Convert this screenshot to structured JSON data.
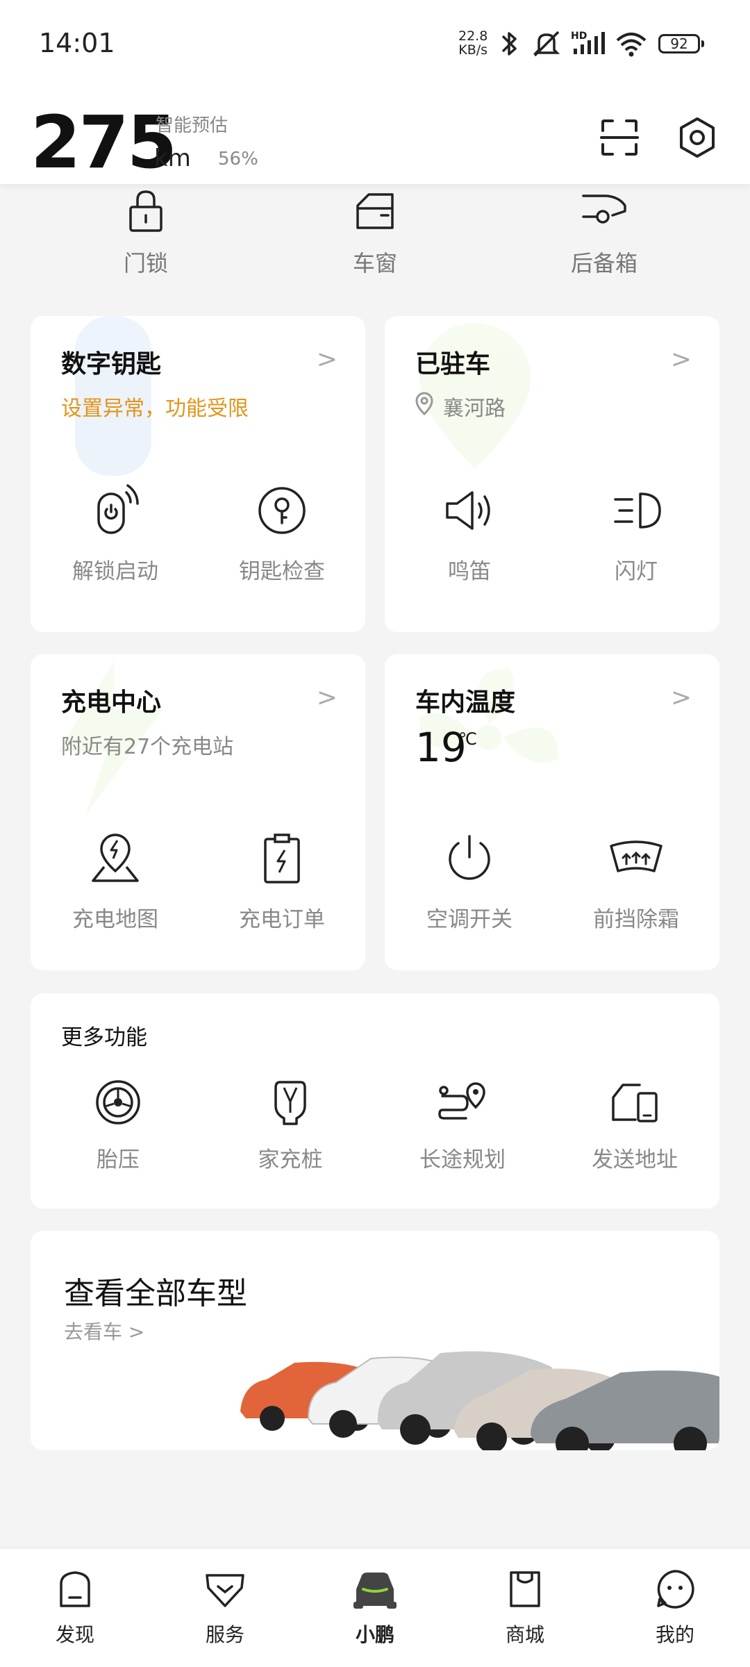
{
  "status_bar": {
    "time": "14:01",
    "net_speed_value": "22.8",
    "net_speed_unit": "KB/s",
    "network_label": "HD",
    "battery": "92",
    "icons": [
      "bluetooth-icon",
      "mute-icon",
      "signal-icon",
      "wifi-icon",
      "battery-icon"
    ]
  },
  "header": {
    "range_value": "275",
    "range_label": "智能预估",
    "range_unit": "km",
    "battery_percent": "56%",
    "icons": [
      "scan-icon",
      "settings-icon"
    ]
  },
  "quick_controls": [
    {
      "label": "门锁",
      "icon": "lock-icon"
    },
    {
      "label": "车窗",
      "icon": "window-icon"
    },
    {
      "label": "后备箱",
      "icon": "trunk-icon"
    }
  ],
  "cards": {
    "digital_key": {
      "title": "数字钥匙",
      "subtitle": "设置异常，功能受限",
      "subtitle_color": "#e0951a",
      "actions": [
        {
          "label": "解锁启动",
          "icon": "unlock-start-icon"
        },
        {
          "label": "钥匙检查",
          "icon": "key-check-icon"
        }
      ]
    },
    "parked": {
      "title": "已驻车",
      "location": "襄河路",
      "actions": [
        {
          "label": "鸣笛",
          "icon": "horn-icon"
        },
        {
          "label": "闪灯",
          "icon": "flash-light-icon"
        }
      ]
    },
    "charging": {
      "title": "充电中心",
      "subtitle": "附近有27个充电站",
      "actions": [
        {
          "label": "充电地图",
          "icon": "charge-map-icon"
        },
        {
          "label": "充电订单",
          "icon": "charge-order-icon"
        }
      ]
    },
    "temperature": {
      "title": "车内温度",
      "value": "19",
      "unit": "℃",
      "actions": [
        {
          "label": "空调开关",
          "icon": "power-icon"
        },
        {
          "label": "前挡除霜",
          "icon": "defrost-icon"
        }
      ]
    }
  },
  "more": {
    "title": "更多功能",
    "items": [
      {
        "label": "胎压",
        "icon": "tire-icon"
      },
      {
        "label": "家充桩",
        "icon": "home-charger-icon"
      },
      {
        "label": "长途规划",
        "icon": "route-icon"
      },
      {
        "label": "发送地址",
        "icon": "send-address-icon"
      }
    ]
  },
  "promo": {
    "title": "查看全部车型",
    "link": "去看车",
    "car_colors": [
      "#e2643a",
      "#f2f2f2",
      "#c9c9c9",
      "#d8cfc6",
      "#8e9398"
    ]
  },
  "bottom_nav": [
    {
      "label": "发现",
      "icon": "discover-icon",
      "active": false
    },
    {
      "label": "服务",
      "icon": "service-icon",
      "active": false
    },
    {
      "label": "小鹏",
      "icon": "car-icon",
      "active": true
    },
    {
      "label": "商城",
      "icon": "mall-icon",
      "active": false
    },
    {
      "label": "我的",
      "icon": "profile-icon",
      "active": false
    }
  ],
  "accent_color": "#8fd63a"
}
